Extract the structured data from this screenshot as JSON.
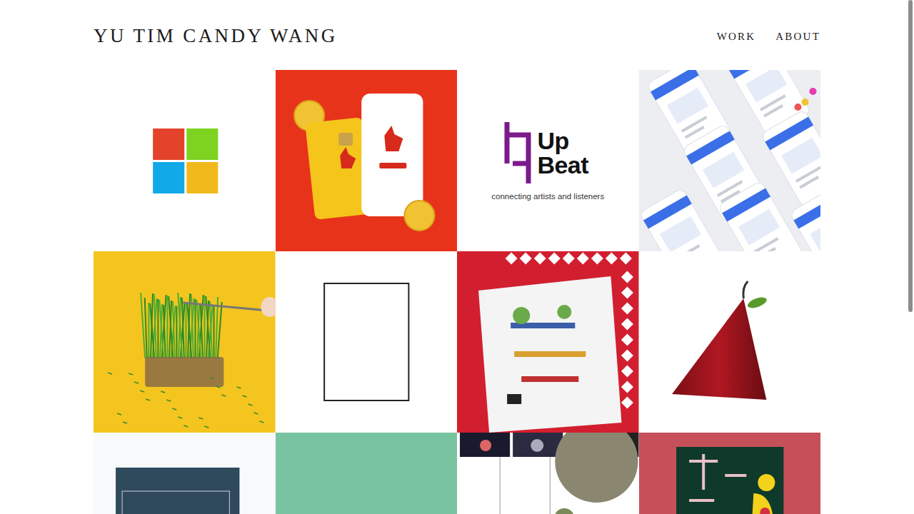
{
  "site": {
    "title": "YU TIM CANDY WANG"
  },
  "nav": [
    {
      "label": "WORK"
    },
    {
      "label": "ABOUT"
    }
  ],
  "tiles": [
    {
      "kind": "microsoft"
    },
    {
      "kind": "pouch"
    },
    {
      "kind": "upbeat",
      "lines": [
        "Up",
        "Beat"
      ],
      "tagline": "connecting artists and listeners"
    },
    {
      "kind": "screens"
    },
    {
      "kind": "grass"
    },
    {
      "kind": "frame"
    },
    {
      "kind": "playground"
    },
    {
      "kind": "pear"
    },
    {
      "kind": "book"
    },
    {
      "kind": "plain"
    },
    {
      "kind": "collage"
    },
    {
      "kind": "poster"
    }
  ]
}
